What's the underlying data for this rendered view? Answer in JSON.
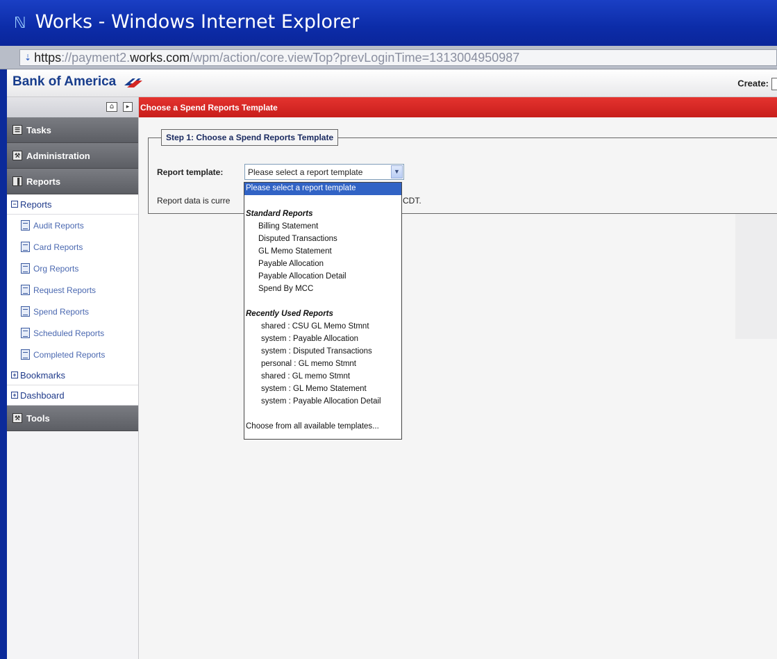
{
  "window": {
    "title": "Works - Windows Internet Explorer",
    "url_scheme": "https",
    "url_dim_1": "://payment2.",
    "url_host": "works.com",
    "url_path": "/wpm/action/core.viewTop?prevLoginTime=1313004950987"
  },
  "brand": {
    "logo_text": "Bank of America",
    "create_label": "Create:"
  },
  "sidebar": {
    "groups": {
      "tasks": "Tasks",
      "administration": "Administration",
      "reports": "Reports",
      "tools": "Tools"
    },
    "reports_tree": {
      "label": "Reports",
      "items": [
        "Audit Reports",
        "Card Reports",
        "Org Reports",
        "Request Reports",
        "Spend Reports",
        "Scheduled Reports",
        "Completed Reports"
      ]
    },
    "bookmarks": "Bookmarks",
    "dashboard": "Dashboard"
  },
  "main": {
    "header": "Choose a Spend Reports Template",
    "step_legend": "Step 1: Choose a Spend Reports Template",
    "template_label": "Report template:",
    "template_value": "Please select a report template",
    "report_data_text": "Report data is curre",
    "report_data_tail": "CDT."
  },
  "dropdown": {
    "selected": "Please select a report template",
    "standard_label": "Standard Reports",
    "standard": [
      "Billing Statement",
      "Disputed Transactions",
      "GL Memo Statement",
      "Payable Allocation",
      "Payable Allocation Detail",
      "Spend By MCC"
    ],
    "recent_label": "Recently Used Reports",
    "recent": [
      "shared : CSU GL Memo Stmnt",
      "system : Payable Allocation",
      "system : Disputed Transactions",
      "personal : GL memo Stmnt",
      "shared : GL memo Stmnt",
      "system : GL Memo Statement",
      "system : Payable Allocation Detail"
    ],
    "choose_all": "Choose from all available templates..."
  },
  "colors": {
    "titlebar": "#0c2ca8",
    "header_red": "#d42724",
    "nav_grey": "#6b6d73",
    "selection_blue": "#3163c5"
  }
}
